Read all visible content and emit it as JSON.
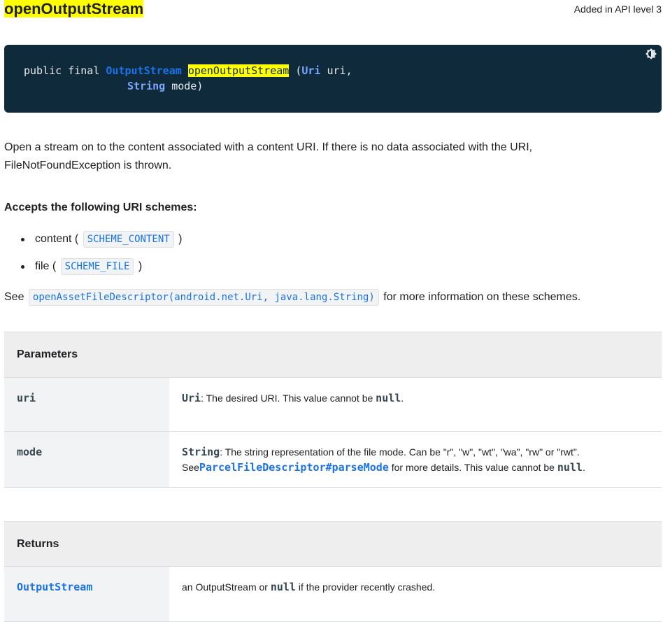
{
  "header": {
    "title": "openOutputStream",
    "api_level": "Added in API level 3"
  },
  "signature": {
    "line1_prefix": "public final ",
    "return_type": "OutputStream",
    "method_name": "openOutputStream",
    "open_paren": " (",
    "param1_type": "Uri",
    "param1_name": " uri,",
    "param2_type": "String",
    "param2_name": " mode)",
    "theme_icon": "dark-mode-toggle-icon"
  },
  "description": "Open a stream on to the content associated with a content URI. If there is no data associated with the URI, FileNotFoundException is thrown.",
  "schemes": {
    "heading": "Accepts the following URI schemes:",
    "items": [
      {
        "label": "content",
        "code": "SCHEME_CONTENT"
      },
      {
        "label": "file",
        "code": "SCHEME_FILE"
      }
    ]
  },
  "see_also": {
    "prefix": "See",
    "link": "openAssetFileDescriptor(android.net.Uri, java.lang.String)",
    "suffix": "for more information on these schemes."
  },
  "parameters": {
    "heading": "Parameters",
    "rows": [
      {
        "name": "uri",
        "type": "Uri",
        "text": ": The desired URI. This value cannot be ",
        "null_kw": "null",
        "end": "."
      },
      {
        "name": "mode",
        "type": "String",
        "text1": ": The string representation of the file mode. Can be \"r\", \"w\", \"wt\", \"wa\", \"rw\" or \"rwt\".",
        "see": "See",
        "link": "ParcelFileDescriptor#parseMode",
        "text2": " for more details. This value cannot be ",
        "null_kw": "null",
        "end": "."
      }
    ]
  },
  "returns": {
    "heading": "Returns",
    "type": "OutputStream",
    "text1": "an OutputStream or ",
    "null_kw": "null",
    "text2": " if the provider recently crashed."
  },
  "colors": {
    "code_background": "#0f2a3a",
    "highlight": "#ffff00",
    "link": "#1a73e8"
  }
}
